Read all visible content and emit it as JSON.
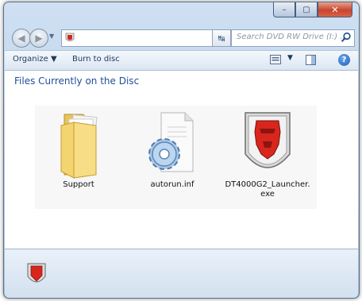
{
  "window": {
    "controls": {
      "minimize": "–",
      "maximize": "▢",
      "close": "✕"
    }
  },
  "nav": {
    "back": "◀",
    "forward": "▶",
    "dropdown": "▼",
    "refresh": "↹",
    "search_placeholder": "Search DVD RW Drive (I:) ..."
  },
  "toolbar": {
    "organize": "Organize ▼",
    "burn": "Burn to disc",
    "views_drop": "▼",
    "help": "?"
  },
  "content": {
    "title": "Files Currently on the Disc",
    "files": [
      {
        "name": "Support",
        "icon": "folder-icon"
      },
      {
        "name": "autorun.inf",
        "icon": "settings-file-icon"
      },
      {
        "name": "DT4000G2_Launcher.exe",
        "icon": "kingston-logo-icon"
      }
    ]
  },
  "colors": {
    "title_blue": "#1e4f9a",
    "kingston_red": "#d8261d"
  }
}
